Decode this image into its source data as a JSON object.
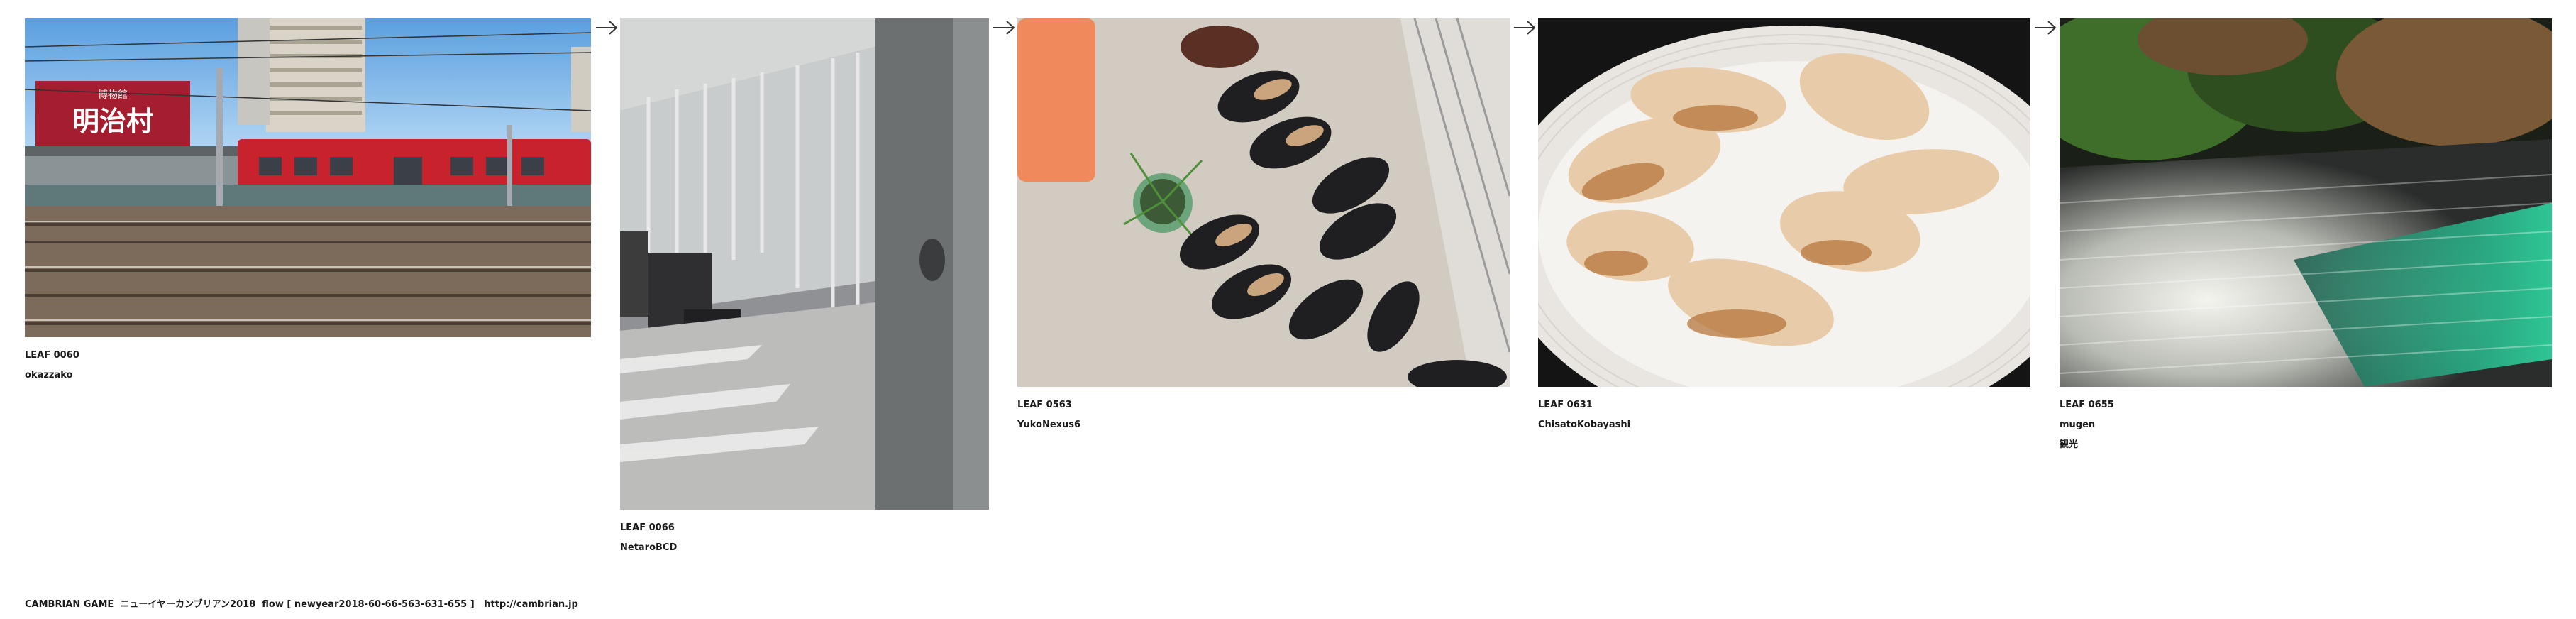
{
  "leaves": [
    {
      "id": "LEAF 0060",
      "author": "okazzako",
      "tag": "",
      "photo_icon": "train-station-photo"
    },
    {
      "id": "LEAF 0066",
      "author": "NetaroBCD",
      "tag": "",
      "photo_icon": "train-interior-photo"
    },
    {
      "id": "LEAF 0563",
      "author": "YukoNexus6",
      "tag": "",
      "photo_icon": "shoes-photo"
    },
    {
      "id": "LEAF 0631",
      "author": "ChisatoKobayashi",
      "tag": "",
      "photo_icon": "gyoza-photo"
    },
    {
      "id": "LEAF 0655",
      "author": "mugen",
      "tag": "観光",
      "photo_icon": "zen-garden-photo"
    }
  ],
  "sign_text": "明治村",
  "sign_subtext": "博物館",
  "footer": {
    "title": "CAMBRIAN GAME  ニューイヤーカンブリアン2018  flow [ newyear2018-60-66-563-631-655 ]",
    "url": "http://cambrian.jp"
  },
  "colors": {
    "train_red": "#c8232c",
    "sign_red": "#a41e30",
    "garden_green": "#2fe0a8",
    "foliage_green": "#3f6e2a"
  }
}
